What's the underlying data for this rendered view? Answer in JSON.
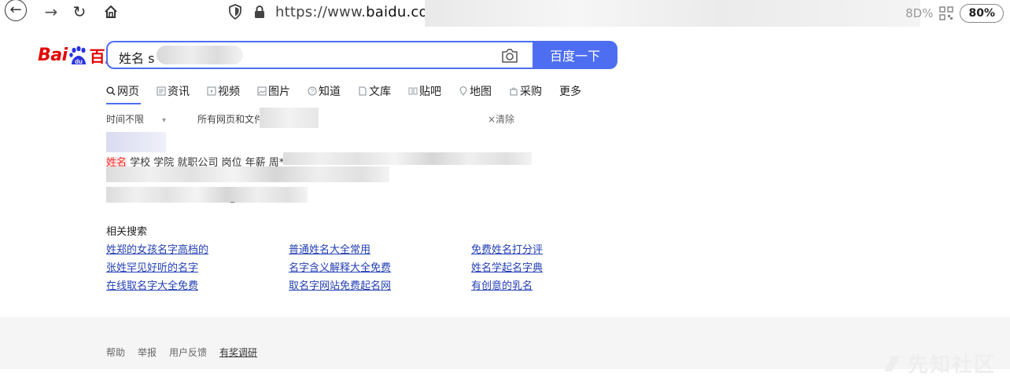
{
  "browser": {
    "url_prefix": "https://www.",
    "url_domain": "baidu.co",
    "right_text": "8D%",
    "zoom": "80%"
  },
  "logo": {
    "left": "Bai",
    "right": "百度"
  },
  "search": {
    "value": "姓名 s",
    "button": "百度一下"
  },
  "tabs": [
    {
      "label": "网页",
      "icon": "search-icon"
    },
    {
      "label": "资讯",
      "icon": "news-icon"
    },
    {
      "label": "视频",
      "icon": "video-icon"
    },
    {
      "label": "图片",
      "icon": "image-icon"
    },
    {
      "label": "知道",
      "icon": "question-icon"
    },
    {
      "label": "文库",
      "icon": "doc-icon"
    },
    {
      "label": "贴吧",
      "icon": "tieba-icon"
    },
    {
      "label": "地图",
      "icon": "map-icon"
    },
    {
      "label": "采购",
      "icon": "shop-icon"
    },
    {
      "label": "更多",
      "icon": ""
    }
  ],
  "filters": {
    "time": "时间不限",
    "scope": "所有网页和文件",
    "clear": "×清除"
  },
  "result": {
    "highlight": "姓名",
    "text": " 学校 学院 就职公司 岗位 年薪 周**",
    "marker": "_"
  },
  "related": {
    "title": "相关搜索",
    "items": [
      "姓郑的女孩名字高档的",
      "普通姓名大全常用",
      "免费姓名打分评",
      "张姓罕见好听的名字",
      "名字含义解释大全免费",
      "姓名学起名字典",
      "在线取名字大全免费",
      "取名字网站免费起名网",
      "有创意的乳名"
    ]
  },
  "footer": {
    "links": [
      "帮助",
      "举报",
      "用户反馈"
    ],
    "survey": "有奖调研"
  },
  "watermark": "先知社区",
  "colors": {
    "brand_blue": "#4e6ef2",
    "brand_red": "#e10602",
    "link": "#2440b3",
    "highlight": "#f73131"
  }
}
